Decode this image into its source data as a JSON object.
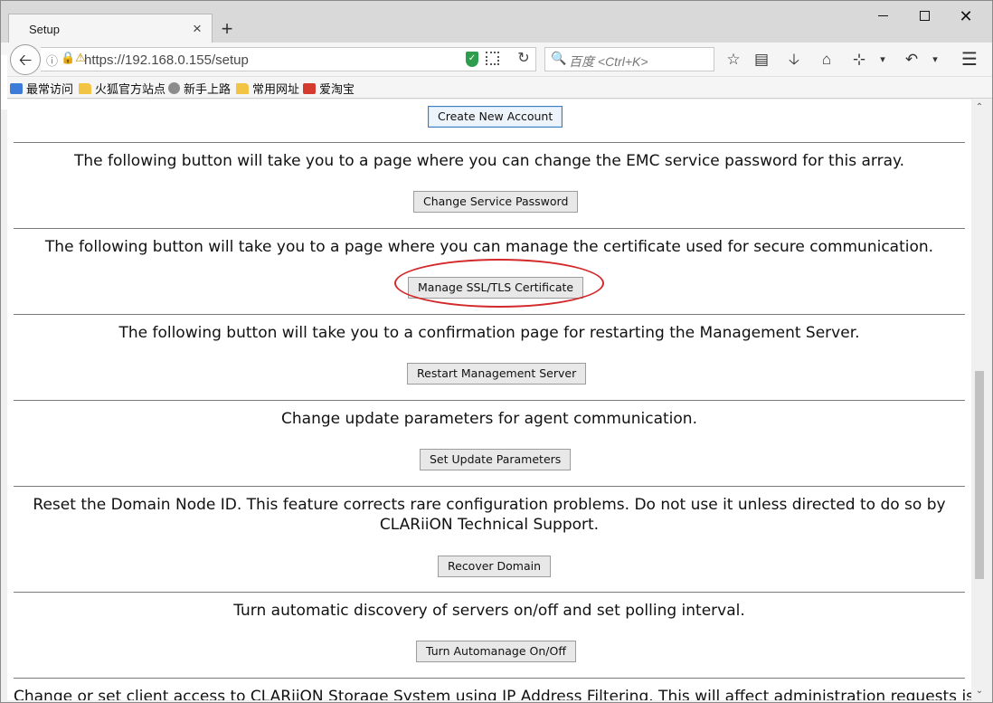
{
  "browser": {
    "tab_title": "Setup",
    "tab_close": "×",
    "new_tab": "+",
    "url": "https://192.168.0.155/setup",
    "search_placeholder": "百度 <Ctrl+K>",
    "window_close": "✕"
  },
  "bookmarks": [
    {
      "label": "最常访问",
      "icon": "most-visited-icon"
    },
    {
      "label": "火狐官方站点",
      "icon": "folder-icon"
    },
    {
      "label": "新手上路",
      "icon": "globe-icon"
    },
    {
      "label": "常用网址",
      "icon": "folder-icon"
    },
    {
      "label": "爱淘宝",
      "icon": "taobao-icon"
    }
  ],
  "page": {
    "create_account_label": "Create New Account",
    "sections": [
      {
        "text": "The following button will take you to a page where you can change the EMC service password for this array.",
        "button": "Change Service Password"
      },
      {
        "text": "The following button will take you to a page where you can manage the certificate used for secure communication.",
        "button": "Manage SSL/TLS Certificate"
      },
      {
        "text": "The following button will take you to a confirmation page for restarting the Management Server.",
        "button": "Restart Management Server"
      },
      {
        "text": "Change update parameters for agent communication.",
        "button": "Set Update Parameters"
      },
      {
        "text": "Reset the Domain Node ID. This feature corrects rare configuration problems. Do not use it unless directed to do so by CLARiiON Technical Support.",
        "button": "Recover Domain"
      },
      {
        "text": "Turn automatic discovery of servers on/off and set polling interval.",
        "button": "Turn Automanage On/Off"
      },
      {
        "text": "Change or set client access to CLARiiON Storage System using IP Address Filtering. This will affect administration requests issued from",
        "button": ""
      }
    ]
  },
  "colors": {
    "highlight_ring": "#d3292a",
    "focus_border": "#3a7fc4"
  }
}
